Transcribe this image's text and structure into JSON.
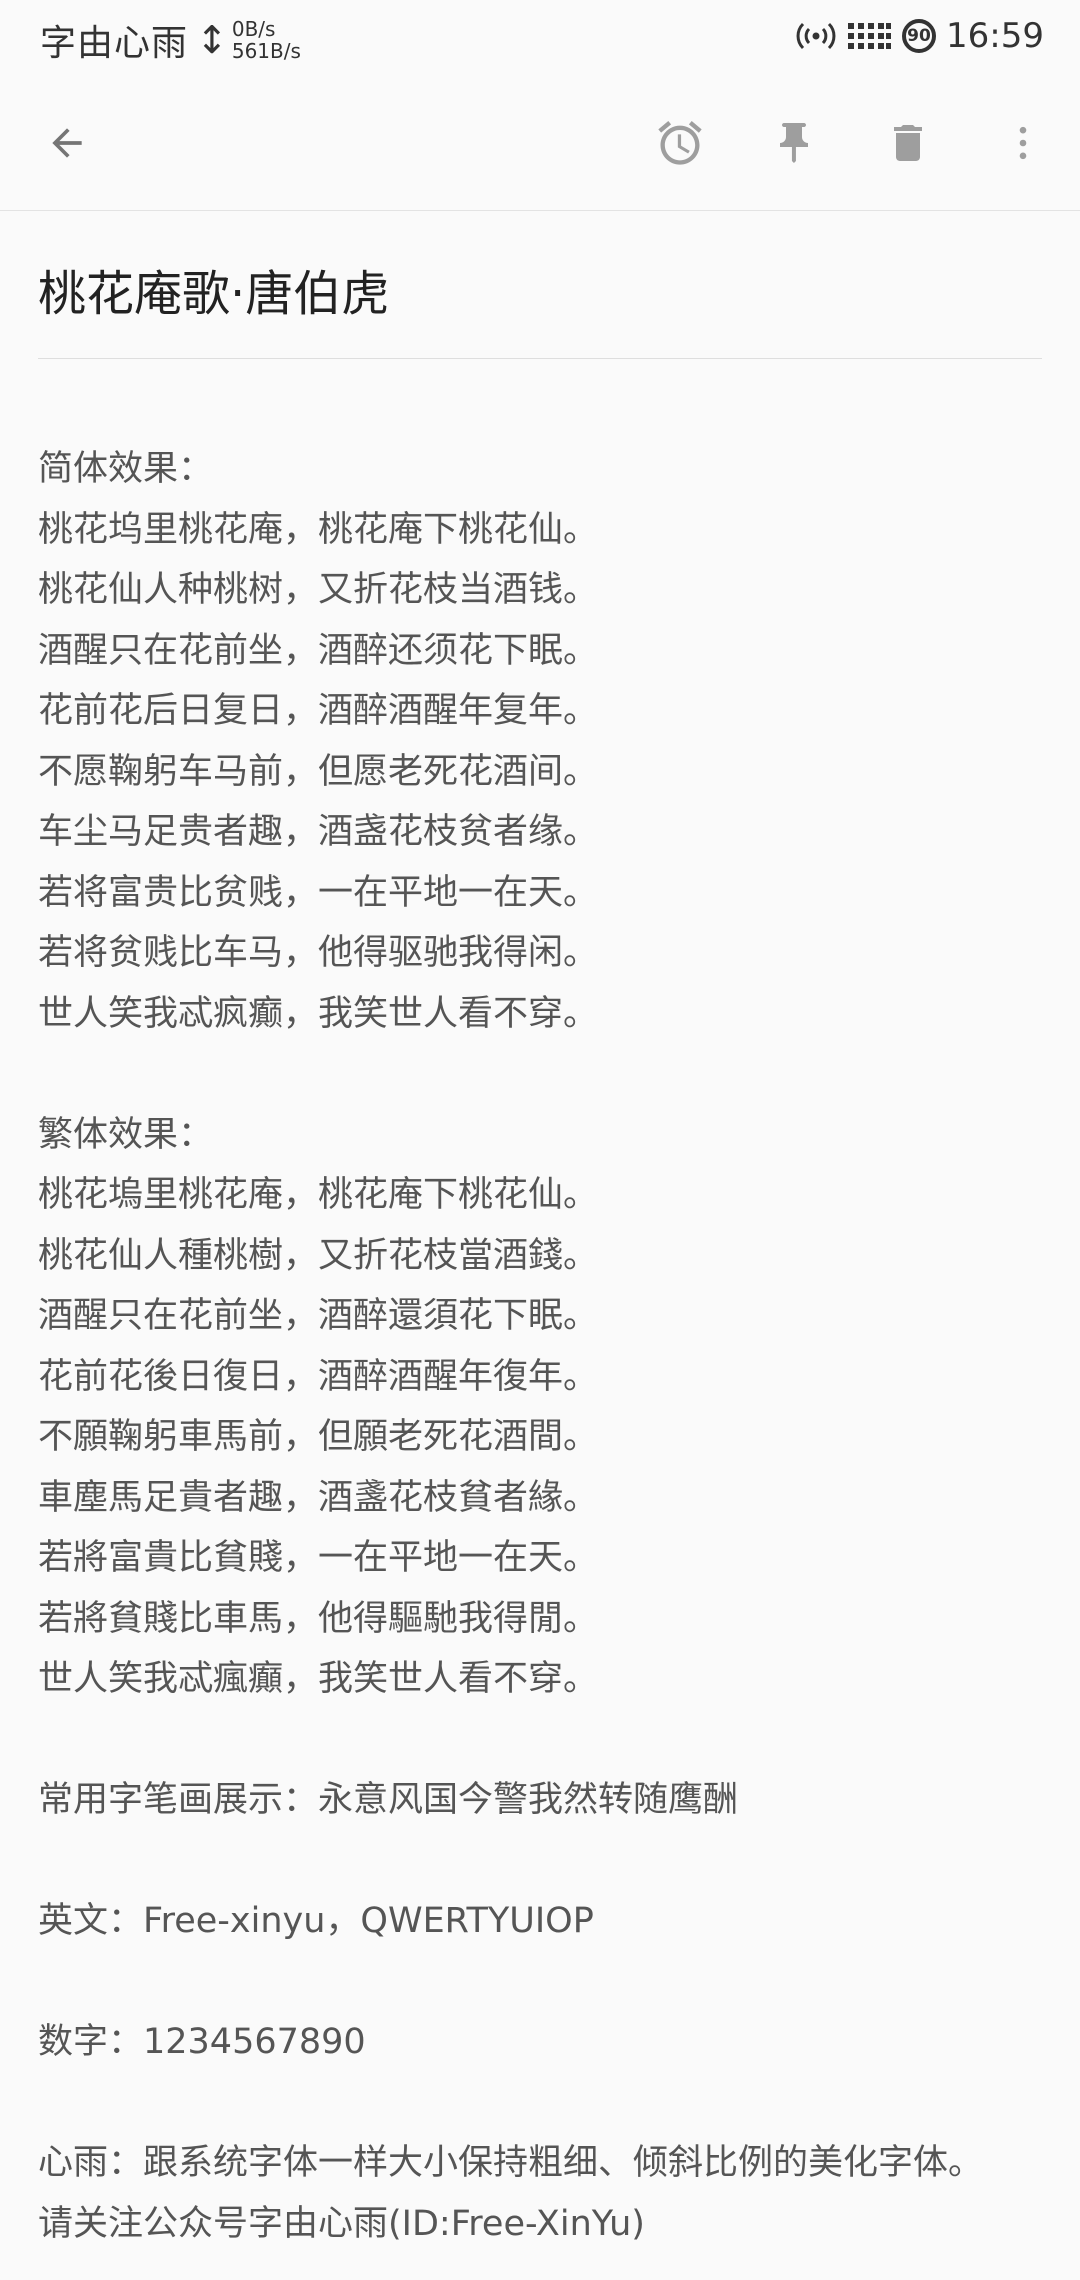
{
  "status_bar": {
    "carrier": "字由心雨",
    "net_up": "0B/s",
    "net_down": "561B/s",
    "battery": "90",
    "time": "16:59"
  },
  "toolbar": {
    "back_icon": "arrow-left-icon",
    "reminder_icon": "alarm-clock-icon",
    "pin_icon": "pin-icon",
    "delete_icon": "trash-icon",
    "more_icon": "more-vertical-icon"
  },
  "note": {
    "title": "桃花庵歌·唐伯虎",
    "simplified_header": "简体效果：",
    "simplified_lines": [
      "桃花坞里桃花庵，桃花庵下桃花仙。",
      "桃花仙人种桃树，又折花枝当酒钱。",
      "酒醒只在花前坐，酒醉还须花下眠。",
      "花前花后日复日，酒醉酒醒年复年。",
      "不愿鞠躬车马前，但愿老死花酒间。",
      "车尘马足贵者趣，酒盏花枝贫者缘。",
      "若将富贵比贫贱，一在平地一在天。",
      "若将贫贱比车马，他得驱驰我得闲。",
      "世人笑我忒疯癫，我笑世人看不穿。"
    ],
    "traditional_header": "繁体效果：",
    "traditional_lines": [
      "桃花塢里桃花庵，桃花庵下桃花仙。",
      "桃花仙人種桃樹，又折花枝當酒錢。",
      "酒醒只在花前坐，酒醉還須花下眠。",
      "花前花後日復日，酒醉酒醒年復年。",
      "不願鞠躬車馬前，但願老死花酒間。",
      "車塵馬足貴者趣，酒盞花枝貧者緣。",
      "若將富貴比貧賤，一在平地一在天。",
      "若將貧賤比車馬，他得驅馳我得閒。",
      "世人笑我忒瘋癲，我笑世人看不穿。"
    ],
    "strokes_line": "常用字笔画展示：永意风国今警我然转随鹰酬",
    "english_line": "英文：Free-xinyu，QWERTYUIOP",
    "digits_line": "数字：1234567890",
    "footer_line1": "心雨：跟系统字体一样大小保持粗细、倾斜比例的美化字体。",
    "footer_line2": "请关注公众号字由心雨(ID:Free-XinYu)"
  }
}
